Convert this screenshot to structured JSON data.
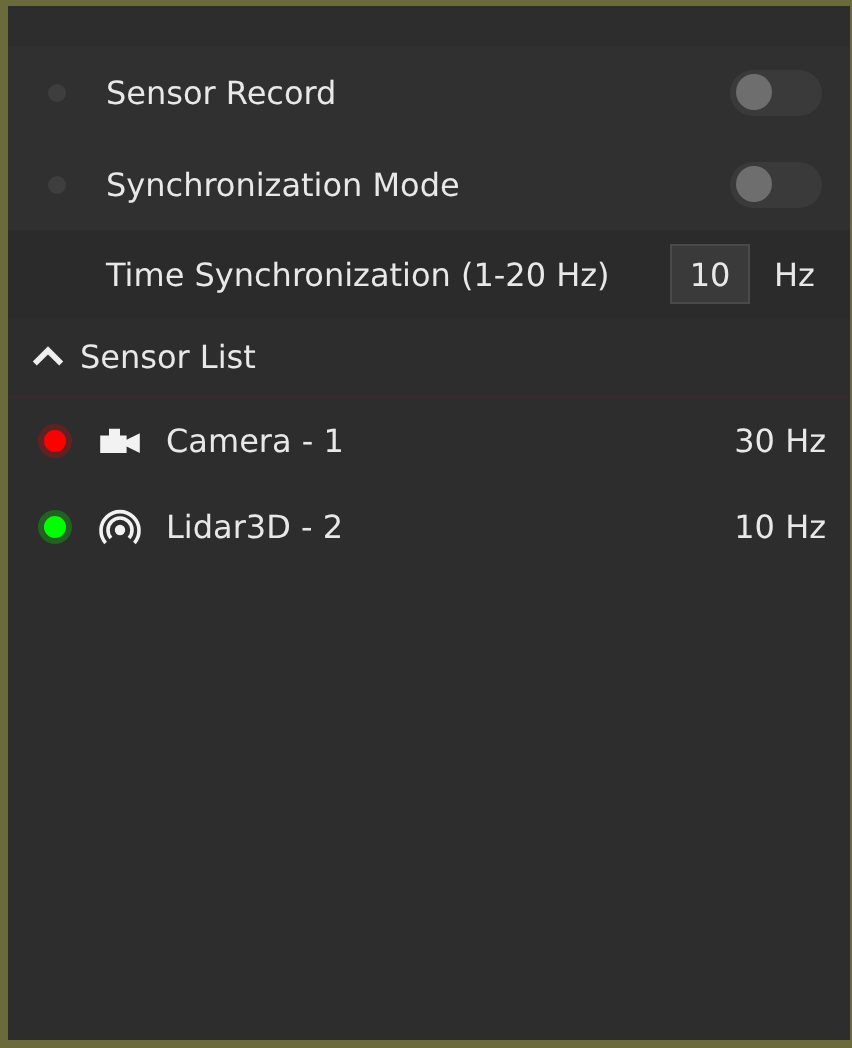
{
  "settings": [
    {
      "kind": "toggle",
      "label": "Sensor Record",
      "on": false
    },
    {
      "kind": "toggle",
      "label": "Synchronization Mode",
      "on": false
    },
    {
      "kind": "number",
      "label": "Time Synchronization (1-20 Hz)",
      "value": "10",
      "unit": "Hz"
    }
  ],
  "sensor_list": {
    "title": "Sensor List",
    "expanded": true,
    "items": [
      {
        "kind": "camera",
        "name": "Camera - 1",
        "rate": "30 Hz",
        "color": "#ff0000"
      },
      {
        "kind": "lidar",
        "name": "Lidar3D - 2",
        "rate": "10 Hz",
        "color": "#00ff00"
      }
    ]
  }
}
